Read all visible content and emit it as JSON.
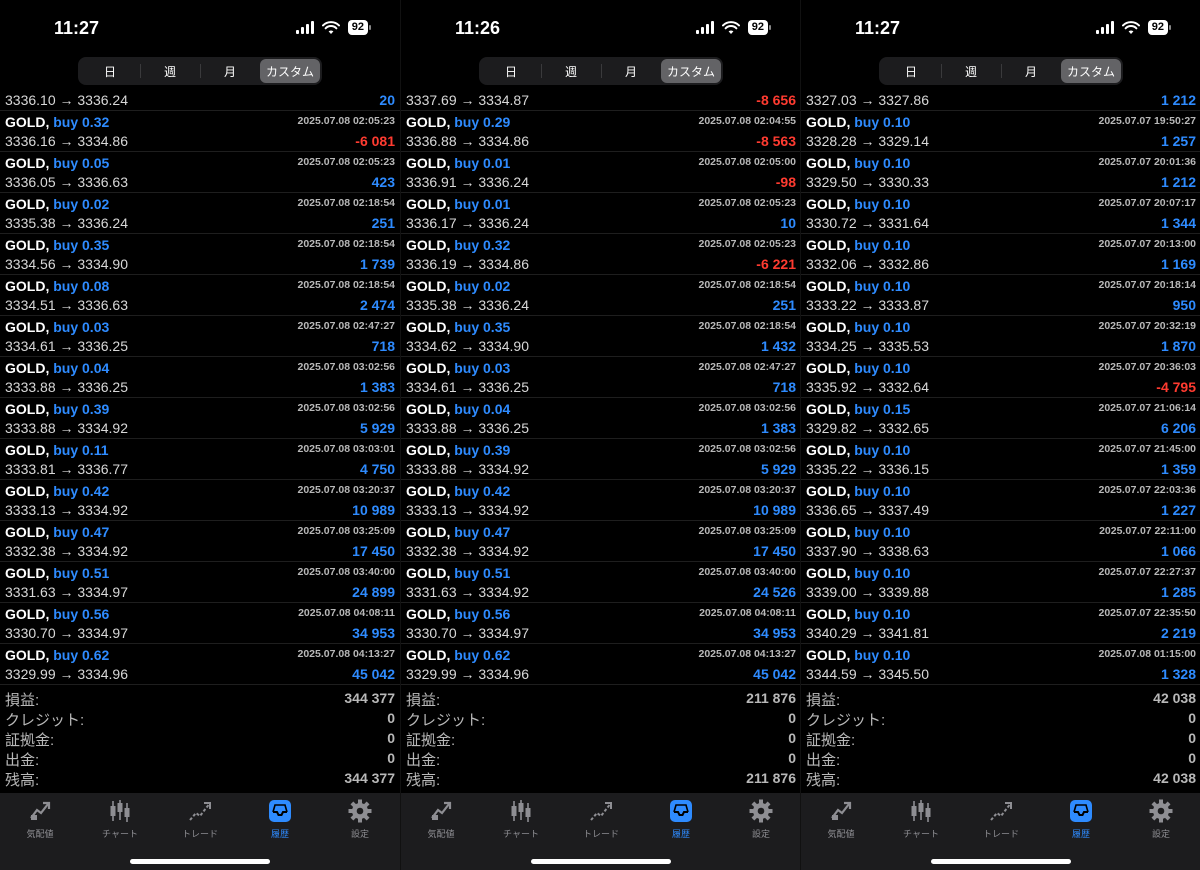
{
  "segments": [
    "日",
    "週",
    "月",
    "カスタム"
  ],
  "active_segment": 3,
  "tabs": [
    {
      "label": "気配値",
      "icon": "quotes-icon"
    },
    {
      "label": "チャート",
      "icon": "candlestick-chart-icon"
    },
    {
      "label": "トレード",
      "icon": "trade-icon"
    },
    {
      "label": "履歴",
      "icon": "history-inbox-icon"
    },
    {
      "label": "設定",
      "icon": "gear-icon"
    }
  ],
  "active_tab": 3,
  "colors": {
    "positive": "#2e8bff",
    "negative": "#ff3b30",
    "background": "#000000",
    "tabbar": "#1c1c1e"
  },
  "panels": [
    {
      "status": {
        "time": "11:27",
        "battery": "92"
      },
      "first_row": {
        "prices": "3336.10 → 3336.24",
        "profit": "20",
        "negative": false
      },
      "trades": [
        {
          "symbol": "GOLD,",
          "side": "buy 0.32",
          "time": "2025.07.08 02:05:23",
          "prices": "3336.16 → 3334.86",
          "profit": "-6 081",
          "negative": true
        },
        {
          "symbol": "GOLD,",
          "side": "buy 0.05",
          "time": "2025.07.08 02:05:23",
          "prices": "3336.05 → 3336.63",
          "profit": "423",
          "negative": false
        },
        {
          "symbol": "GOLD,",
          "side": "buy 0.02",
          "time": "2025.07.08 02:18:54",
          "prices": "3335.38 → 3336.24",
          "profit": "251",
          "negative": false
        },
        {
          "symbol": "GOLD,",
          "side": "buy 0.35",
          "time": "2025.07.08 02:18:54",
          "prices": "3334.56 → 3334.90",
          "profit": "1 739",
          "negative": false
        },
        {
          "symbol": "GOLD,",
          "side": "buy 0.08",
          "time": "2025.07.08 02:18:54",
          "prices": "3334.51 → 3336.63",
          "profit": "2 474",
          "negative": false
        },
        {
          "symbol": "GOLD,",
          "side": "buy 0.03",
          "time": "2025.07.08 02:47:27",
          "prices": "3334.61 → 3336.25",
          "profit": "718",
          "negative": false
        },
        {
          "symbol": "GOLD,",
          "side": "buy 0.04",
          "time": "2025.07.08 03:02:56",
          "prices": "3333.88 → 3336.25",
          "profit": "1 383",
          "negative": false
        },
        {
          "symbol": "GOLD,",
          "side": "buy 0.39",
          "time": "2025.07.08 03:02:56",
          "prices": "3333.88 → 3334.92",
          "profit": "5 929",
          "negative": false
        },
        {
          "symbol": "GOLD,",
          "side": "buy 0.11",
          "time": "2025.07.08 03:03:01",
          "prices": "3333.81 → 3336.77",
          "profit": "4 750",
          "negative": false
        },
        {
          "symbol": "GOLD,",
          "side": "buy 0.42",
          "time": "2025.07.08 03:20:37",
          "prices": "3333.13 → 3334.92",
          "profit": "10 989",
          "negative": false
        },
        {
          "symbol": "GOLD,",
          "side": "buy 0.47",
          "time": "2025.07.08 03:25:09",
          "prices": "3332.38 → 3334.92",
          "profit": "17 450",
          "negative": false
        },
        {
          "symbol": "GOLD,",
          "side": "buy 0.51",
          "time": "2025.07.08 03:40:00",
          "prices": "3331.63 → 3334.97",
          "profit": "24 899",
          "negative": false
        },
        {
          "symbol": "GOLD,",
          "side": "buy 0.56",
          "time": "2025.07.08 04:08:11",
          "prices": "3330.70 → 3334.97",
          "profit": "34 953",
          "negative": false
        },
        {
          "symbol": "GOLD,",
          "side": "buy 0.62",
          "time": "2025.07.08 04:13:27",
          "prices": "3329.99 → 3334.96",
          "profit": "45 042",
          "negative": false
        }
      ],
      "summary": [
        {
          "label": "損益:",
          "value": "344 377"
        },
        {
          "label": "クレジット:",
          "value": "0"
        },
        {
          "label": "証拠金:",
          "value": "0"
        },
        {
          "label": "出金:",
          "value": "0"
        },
        {
          "label": "残高:",
          "value": "344 377"
        }
      ]
    },
    {
      "status": {
        "time": "11:26",
        "battery": "92"
      },
      "first_row": {
        "prices": "3337.69 → 3334.87",
        "profit": "-8 656",
        "negative": true
      },
      "trades": [
        {
          "symbol": "GOLD,",
          "side": "buy 0.29",
          "time": "2025.07.08 02:04:55",
          "prices": "3336.88 → 3334.86",
          "profit": "-8 563",
          "negative": true
        },
        {
          "symbol": "GOLD,",
          "side": "buy 0.01",
          "time": "2025.07.08 02:05:00",
          "prices": "3336.91 → 3336.24",
          "profit": "-98",
          "negative": true
        },
        {
          "symbol": "GOLD,",
          "side": "buy 0.01",
          "time": "2025.07.08 02:05:23",
          "prices": "3336.17 → 3336.24",
          "profit": "10",
          "negative": false
        },
        {
          "symbol": "GOLD,",
          "side": "buy 0.32",
          "time": "2025.07.08 02:05:23",
          "prices": "3336.19 → 3334.86",
          "profit": "-6 221",
          "negative": true
        },
        {
          "symbol": "GOLD,",
          "side": "buy 0.02",
          "time": "2025.07.08 02:18:54",
          "prices": "3335.38 → 3336.24",
          "profit": "251",
          "negative": false
        },
        {
          "symbol": "GOLD,",
          "side": "buy 0.35",
          "time": "2025.07.08 02:18:54",
          "prices": "3334.62 → 3334.90",
          "profit": "1 432",
          "negative": false
        },
        {
          "symbol": "GOLD,",
          "side": "buy 0.03",
          "time": "2025.07.08 02:47:27",
          "prices": "3334.61 → 3336.25",
          "profit": "718",
          "negative": false
        },
        {
          "symbol": "GOLD,",
          "side": "buy 0.04",
          "time": "2025.07.08 03:02:56",
          "prices": "3333.88 → 3336.25",
          "profit": "1 383",
          "negative": false
        },
        {
          "symbol": "GOLD,",
          "side": "buy 0.39",
          "time": "2025.07.08 03:02:56",
          "prices": "3333.88 → 3334.92",
          "profit": "5 929",
          "negative": false
        },
        {
          "symbol": "GOLD,",
          "side": "buy 0.42",
          "time": "2025.07.08 03:20:37",
          "prices": "3333.13 → 3334.92",
          "profit": "10 989",
          "negative": false
        },
        {
          "symbol": "GOLD,",
          "side": "buy 0.47",
          "time": "2025.07.08 03:25:09",
          "prices": "3332.38 → 3334.92",
          "profit": "17 450",
          "negative": false
        },
        {
          "symbol": "GOLD,",
          "side": "buy 0.51",
          "time": "2025.07.08 03:40:00",
          "prices": "3331.63 → 3334.92",
          "profit": "24 526",
          "negative": false
        },
        {
          "symbol": "GOLD,",
          "side": "buy 0.56",
          "time": "2025.07.08 04:08:11",
          "prices": "3330.70 → 3334.97",
          "profit": "34 953",
          "negative": false
        },
        {
          "symbol": "GOLD,",
          "side": "buy 0.62",
          "time": "2025.07.08 04:13:27",
          "prices": "3329.99 → 3334.96",
          "profit": "45 042",
          "negative": false
        }
      ],
      "summary": [
        {
          "label": "損益:",
          "value": "211 876"
        },
        {
          "label": "クレジット:",
          "value": "0"
        },
        {
          "label": "証拠金:",
          "value": "0"
        },
        {
          "label": "出金:",
          "value": "0"
        },
        {
          "label": "残高:",
          "value": "211 876"
        }
      ]
    },
    {
      "status": {
        "time": "11:27",
        "battery": "92"
      },
      "first_row": {
        "prices": "3327.03 → 3327.86",
        "profit": "1 212",
        "negative": false
      },
      "trades": [
        {
          "symbol": "GOLD,",
          "side": "buy 0.10",
          "time": "2025.07.07 19:50:27",
          "prices": "3328.28 → 3329.14",
          "profit": "1 257",
          "negative": false
        },
        {
          "symbol": "GOLD,",
          "side": "buy 0.10",
          "time": "2025.07.07 20:01:36",
          "prices": "3329.50 → 3330.33",
          "profit": "1 212",
          "negative": false
        },
        {
          "symbol": "GOLD,",
          "side": "buy 0.10",
          "time": "2025.07.07 20:07:17",
          "prices": "3330.72 → 3331.64",
          "profit": "1 344",
          "negative": false
        },
        {
          "symbol": "GOLD,",
          "side": "buy 0.10",
          "time": "2025.07.07 20:13:00",
          "prices": "3332.06 → 3332.86",
          "profit": "1 169",
          "negative": false
        },
        {
          "symbol": "GOLD,",
          "side": "buy 0.10",
          "time": "2025.07.07 20:18:14",
          "prices": "3333.22 → 3333.87",
          "profit": "950",
          "negative": false
        },
        {
          "symbol": "GOLD,",
          "side": "buy 0.10",
          "time": "2025.07.07 20:32:19",
          "prices": "3334.25 → 3335.53",
          "profit": "1 870",
          "negative": false
        },
        {
          "symbol": "GOLD,",
          "side": "buy 0.10",
          "time": "2025.07.07 20:36:03",
          "prices": "3335.92 → 3332.64",
          "profit": "-4 795",
          "negative": true
        },
        {
          "symbol": "GOLD,",
          "side": "buy 0.15",
          "time": "2025.07.07 21:06:14",
          "prices": "3329.82 → 3332.65",
          "profit": "6 206",
          "negative": false
        },
        {
          "symbol": "GOLD,",
          "side": "buy 0.10",
          "time": "2025.07.07 21:45:00",
          "prices": "3335.22 → 3336.15",
          "profit": "1 359",
          "negative": false
        },
        {
          "symbol": "GOLD,",
          "side": "buy 0.10",
          "time": "2025.07.07 22:03:36",
          "prices": "3336.65 → 3337.49",
          "profit": "1 227",
          "negative": false
        },
        {
          "symbol": "GOLD,",
          "side": "buy 0.10",
          "time": "2025.07.07 22:11:00",
          "prices": "3337.90 → 3338.63",
          "profit": "1 066",
          "negative": false
        },
        {
          "symbol": "GOLD,",
          "side": "buy 0.10",
          "time": "2025.07.07 22:27:37",
          "prices": "3339.00 → 3339.88",
          "profit": "1 285",
          "negative": false
        },
        {
          "symbol": "GOLD,",
          "side": "buy 0.10",
          "time": "2025.07.07 22:35:50",
          "prices": "3340.29 → 3341.81",
          "profit": "2 219",
          "negative": false
        },
        {
          "symbol": "GOLD,",
          "side": "buy 0.10",
          "time": "2025.07.08 01:15:00",
          "prices": "3344.59 → 3345.50",
          "profit": "1 328",
          "negative": false
        }
      ],
      "summary": [
        {
          "label": "損益:",
          "value": "42 038"
        },
        {
          "label": "クレジット:",
          "value": "0"
        },
        {
          "label": "証拠金:",
          "value": "0"
        },
        {
          "label": "出金:",
          "value": "0"
        },
        {
          "label": "残高:",
          "value": "42 038"
        }
      ]
    }
  ]
}
